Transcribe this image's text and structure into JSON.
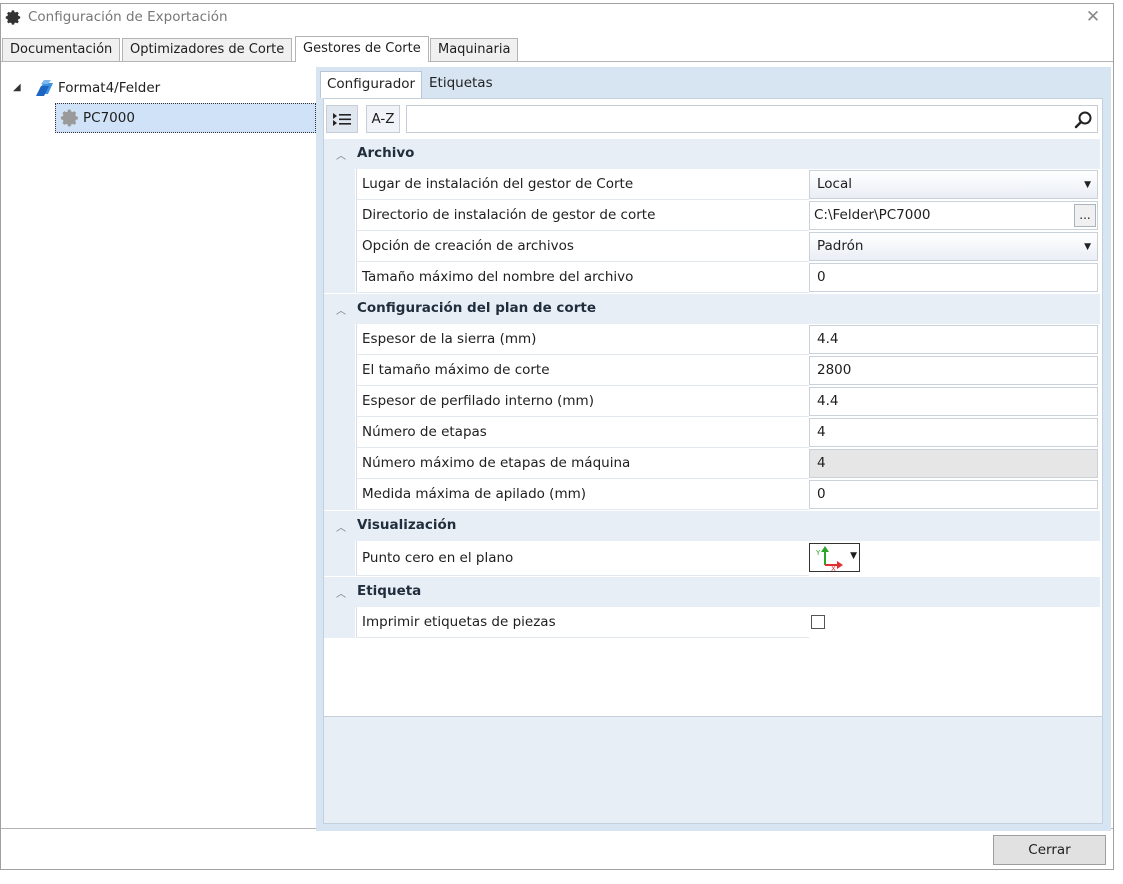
{
  "window": {
    "title": "Configuración de Exportación",
    "close_glyph": "✕",
    "icon": "gear-icon"
  },
  "main_tabs": [
    {
      "label": "Documentación"
    },
    {
      "label": "Optimizadores de Corte"
    },
    {
      "label": "Gestores de Corte",
      "active": true
    },
    {
      "label": "Maquinaria"
    }
  ],
  "tree": {
    "root": {
      "label": "Format4/Felder",
      "icon": "folder-stack-icon",
      "expanded": true
    },
    "child": {
      "label": "PC7000",
      "icon": "gear-icon",
      "selected": true
    }
  },
  "inner_tabs": [
    {
      "label": "Configurador",
      "active": true
    },
    {
      "label": "Etiquetas"
    }
  ],
  "toolbar": {
    "categorized_icon": "categorized-list-icon",
    "az_label": "A-Z",
    "search_placeholder": "",
    "search_icon": "search-icon"
  },
  "categories": [
    {
      "label": "Archivo",
      "props": [
        {
          "name": "Lugar de instalación del gestor de Corte",
          "value": "Local",
          "kind": "combo"
        },
        {
          "name": "Directorio de instalación de gestor de corte",
          "value": "C:\\Felder\\PC7000",
          "kind": "path",
          "button": "..."
        },
        {
          "name": "Opción de creación de archivos",
          "value": "Padrón",
          "kind": "combo"
        },
        {
          "name": "Tamaño máximo del nombre del archivo",
          "value": "0",
          "kind": "text"
        }
      ]
    },
    {
      "label": "Configuración del plan de corte",
      "props": [
        {
          "name": "Espesor de la sierra (mm)",
          "value": "4.4",
          "kind": "text"
        },
        {
          "name": "El tamaño máximo de corte",
          "value": "2800",
          "kind": "text"
        },
        {
          "name": "Espesor de perfilado interno (mm)",
          "value": "4.4",
          "kind": "text"
        },
        {
          "name": "Número de etapas",
          "value": "4",
          "kind": "text"
        },
        {
          "name": "Número máximo de etapas de máquina",
          "value": "4",
          "kind": "readonly"
        },
        {
          "name": "Medida máxima de apilado (mm)",
          "value": "0",
          "kind": "text"
        }
      ]
    },
    {
      "label": "Visualización",
      "props": [
        {
          "name": "Punto cero en el plano",
          "kind": "axis",
          "axis_y": "Y",
          "axis_x": "X"
        }
      ]
    },
    {
      "label": "Etiqueta",
      "props": [
        {
          "name": "Imprimir etiquetas de piezas",
          "kind": "checkbox",
          "checked": false
        }
      ]
    }
  ],
  "footer": {
    "close_label": "Cerrar"
  },
  "colors": {
    "accent_blue": "#1e78d6",
    "axis_red": "#e03030",
    "axis_green": "#2aa52a"
  }
}
